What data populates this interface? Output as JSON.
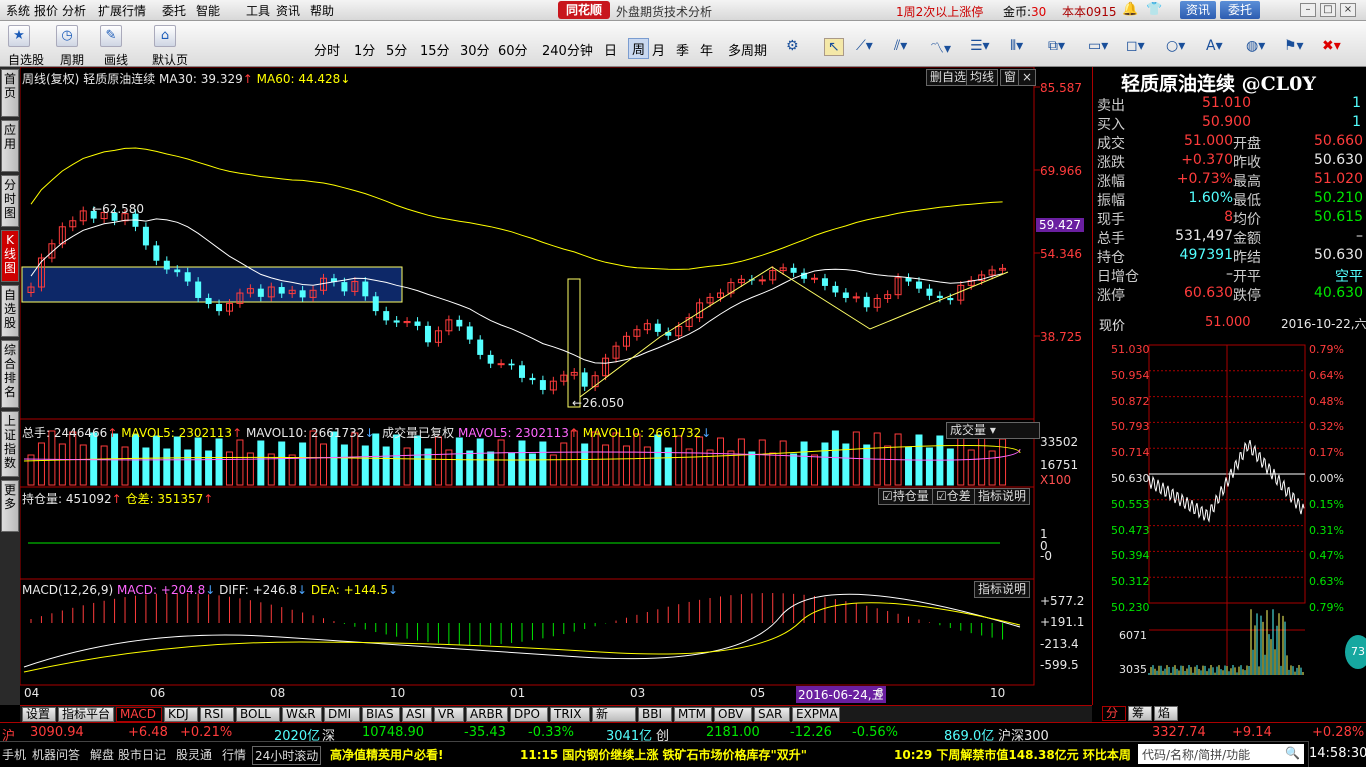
{
  "menu": {
    "items": [
      "系统",
      "报价",
      "分析",
      "扩展行情",
      "委托",
      "智能",
      "工具",
      "资讯",
      "帮助"
    ],
    "logo": "同花顺",
    "app_title": "外盘期货技术分析",
    "ad": "1周2次以上涨停",
    "coins_label": "金币:",
    "coins_value": "30",
    "version": "本本0915",
    "news_btn": "资讯",
    "trade_btn": "委托"
  },
  "toolbar": {
    "buttons": [
      {
        "label": "自选股",
        "icon": "star-icon"
      },
      {
        "label": "周期",
        "icon": "clock-icon"
      },
      {
        "label": "画线",
        "icon": "pen-icon"
      },
      {
        "label": "默认页",
        "icon": "home-icon"
      }
    ],
    "periods": [
      "分时",
      "1分",
      "5分",
      "15分",
      "30分",
      "60分",
      "240分钟",
      "日",
      "周",
      "月",
      "季",
      "年",
      "多周期"
    ],
    "active_period": "周"
  },
  "left_tabs": [
    "首页",
    "应用",
    "分时图",
    "K线图",
    "自选股",
    "综合排名",
    "上证指数",
    "更多"
  ],
  "active_left_tab": "K线图",
  "main": {
    "header_title": "周线(复权)",
    "instrument": "轻质原油连续",
    "ma30_label": "MA30: 39.329",
    "ma60_label": "MA60: 44.428",
    "btn_delete": "删自选",
    "btn_ma": "均线",
    "btn_win": "窗",
    "price_axis": [
      "85.587",
      "69.966",
      "54.346",
      "38.725"
    ],
    "current_price_tag": "59.427",
    "high_annot": "62.580",
    "low_annot": "26.050"
  },
  "volume": {
    "total_label": "总手: 2446466",
    "mavol5": "MAVOL5: 2302113",
    "mavol10": "MAVOL10: 2661732",
    "ctrl_label": "成交量已复权",
    "mavol5b": "MAVOL5: 2302113",
    "mavol10b": "MAVOL10: 2661732",
    "dropdown": "成交量",
    "axis": [
      "33502",
      "16751",
      "X100"
    ]
  },
  "oi": {
    "label": "持仓量: 451092",
    "diff_label": "仓差: 351357",
    "cb1": "持仓量",
    "cb2": "仓差",
    "explain": "指标说明",
    "axis": [
      "1",
      "0",
      "-0"
    ]
  },
  "macd": {
    "label": "MACD(12,26,9)",
    "macd_val": "MACD: +204.8",
    "diff_val": "DIFF: +246.8",
    "dea_val": "DEA: +144.5",
    "explain": "指标说明",
    "axis": [
      "+577.2",
      "+191.1",
      "-213.4",
      "-599.5"
    ]
  },
  "xaxis": [
    "04",
    "06",
    "08",
    "10",
    "01",
    "03",
    "05",
    "2016-06-24,五",
    "8",
    "10"
  ],
  "quote": {
    "title": "轻质原油连续 @CL0Y",
    "rows": [
      {
        "l": "卖出",
        "v1": "51.010",
        "v2": "1",
        "c1": "red",
        "c2": "cyan"
      },
      {
        "l": "买入",
        "v1": "50.900",
        "v2": "1",
        "c1": "red",
        "c2": "cyan"
      }
    ],
    "rows2": [
      {
        "l": "成交",
        "v": "51.000",
        "c": "red",
        "l2": "开盘",
        "v2": "50.660",
        "c2": "red"
      },
      {
        "l": "涨跌",
        "v": "+0.370",
        "c": "red",
        "l2": "昨收",
        "v2": "50.630",
        "c2": "wht"
      },
      {
        "l": "涨幅",
        "v": "+0.73%",
        "c": "red",
        "l2": "最高",
        "v2": "51.020",
        "c2": "red"
      },
      {
        "l": "振幅",
        "v": "1.60%",
        "c": "cyan",
        "l2": "最低",
        "v2": "50.210",
        "c2": "grn"
      },
      {
        "l": "现手",
        "v": "8",
        "c": "red",
        "l2": "均价",
        "v2": "50.615",
        "c2": "grn"
      },
      {
        "l": "总手",
        "v": "531,497",
        "c": "wht",
        "l2": "金额",
        "v2": "–",
        "c2": "wht"
      },
      {
        "l": "持仓",
        "v": "497391",
        "c": "cyan",
        "l2": "昨结",
        "v2": "50.630",
        "c2": "wht"
      },
      {
        "l": "日增仓",
        "v": "–",
        "c": "wht",
        "l2": "开平",
        "v2": "空平",
        "c2": "cyan"
      },
      {
        "l": "涨停",
        "v": "60.630",
        "c": "red",
        "l2": "跌停",
        "v2": "40.630",
        "c2": "grn"
      }
    ],
    "now_label": "现价",
    "now_val": "51.000",
    "date": "2016-10-22,六",
    "price_axis": [
      "51.030",
      "50.954",
      "50.872",
      "50.793",
      "50.714",
      "50.630",
      "50.553",
      "50.473",
      "50.394",
      "50.312",
      "50.230"
    ],
    "pct_axis": [
      "0.79%",
      "0.64%",
      "0.48%",
      "0.32%",
      "0.17%",
      "0.00%",
      "0.15%",
      "0.31%",
      "0.47%",
      "0.63%",
      "0.79%"
    ],
    "vol_axis": [
      "6071",
      "3035"
    ],
    "badge": "73",
    "tabs": [
      "分",
      "筹",
      "焰"
    ]
  },
  "bottom_tabs": [
    "设置",
    "指标平台",
    "MACD",
    "KDJ",
    "RSI",
    "BOLL",
    "W&R",
    "DMI",
    "BIAS",
    "ASI",
    "VR",
    "ARBR",
    "DPO",
    "TRIX",
    "新DMA",
    "BBI",
    "MTM",
    "OBV",
    "SAR",
    "EXPMA"
  ],
  "active_bottom_tab": "MACD",
  "index_bar": {
    "sh_label": "沪",
    "sh_val": "3090.94",
    "sh_chg": "+6.48",
    "sh_pct": "+0.21%",
    "sh_amt": "2020亿",
    "sz_label": "深",
    "sz_val": "10748.90",
    "sz_chg": "-35.43",
    "sz_pct": "-0.33%",
    "sz_amt": "3041亿",
    "cy_label": "创",
    "cy_val": "2181.00",
    "cy_chg": "-12.26",
    "cy_pct": "-0.56%",
    "cy_amt": "869.0亿",
    "hs_label": "沪深300",
    "hs_val": "3327.74",
    "hs_chg": "+9.14",
    "hs_pct": "+0.28%"
  },
  "status": {
    "items": [
      "手机",
      "机器问答",
      "解盘",
      "股市日记",
      "股灵通",
      "行情"
    ],
    "scroll_label": "24小时滚动",
    "news1": "高净值精英用户必看!",
    "news2": "11:15 国内钢价继续上涨 铁矿石市场价格库存\"双升\"",
    "news3": "10:29 下周解禁市值148.38亿元 环比本周",
    "search": "代码/名称/简拼/功能",
    "clock": "14:58:30"
  },
  "chart_data": {
    "type": "candlestick",
    "title": "轻质原油连续 周线(复权)",
    "ylim": [
      26.05,
      62.58
    ],
    "annotations": {
      "high": 62.58,
      "low": 26.05
    },
    "ma": {
      "MA30": 39.329,
      "MA60": 44.428
    },
    "candles_close": [
      47.6,
      52.9,
      55.5,
      58.6,
      59.7,
      61.5,
      60.1,
      61.2,
      59.7,
      61.0,
      58.6,
      55.2,
      52.4,
      50.8,
      50.3,
      48.6,
      45.6,
      44.5,
      43.2,
      44.6,
      46.5,
      47.3,
      45.8,
      47.6,
      46.4,
      47.0,
      45.7,
      47.0,
      49.2,
      48.5,
      46.8,
      48.6,
      45.9,
      43.2,
      41.5,
      41.1,
      41.3,
      40.5,
      37.5,
      39.6,
      41.6,
      40.4,
      38.0,
      35.2,
      33.6,
      33.6,
      33.3,
      31.0,
      30.6,
      28.8,
      30.4,
      31.5,
      32.0,
      29.4,
      31.4,
      34.6,
      36.8,
      38.6,
      39.8,
      40.9,
      39.4,
      38.7,
      40.4,
      42.0,
      44.7,
      45.7,
      46.5,
      48.4,
      49.0,
      48.8,
      48.9,
      50.6,
      51.1,
      50.2,
      49.1,
      49.2,
      47.8,
      46.6,
      45.6,
      45.8,
      43.9,
      45.5,
      46.2,
      49.3,
      48.6,
      47.3,
      46.0,
      45.6,
      45.2,
      47.9,
      48.8,
      49.8,
      50.7,
      51.0
    ]
  }
}
